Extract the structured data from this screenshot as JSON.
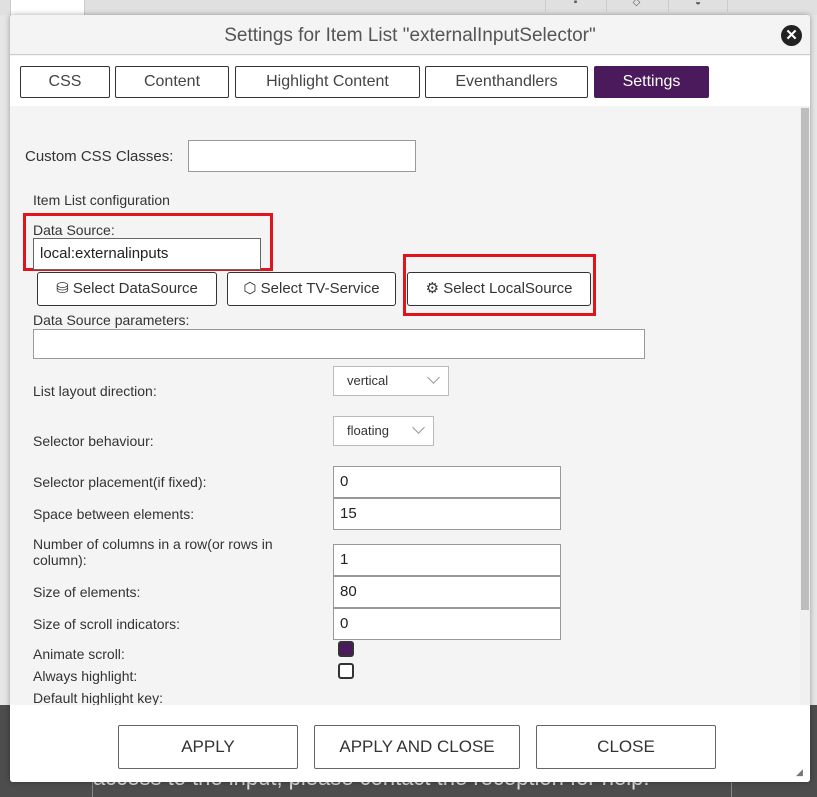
{
  "background": {
    "message": "access to the input, please contact the reception for help."
  },
  "dialog": {
    "title": "Settings for Item List \"externalInputSelector\"",
    "close_icon": "close-circle-icon",
    "tabs": [
      {
        "label": "CSS",
        "active": false
      },
      {
        "label": "Content",
        "active": false
      },
      {
        "label": "Highlight Content",
        "active": false
      },
      {
        "label": "Eventhandlers",
        "active": false
      },
      {
        "label": "Settings",
        "active": true
      }
    ],
    "accent_color": "#4a1a5c",
    "highlight_color": "#e0141b"
  },
  "settings": {
    "custom_css_label": "Custom CSS Classes:",
    "custom_css_value": "",
    "section_title": "Item List configuration",
    "data_source_label": "Data Source:",
    "data_source_value": "local:externalinputs",
    "select_datasource": "Select DataSource",
    "select_tv_service": "Select TV-Service",
    "select_local_source": "Select LocalSource",
    "ds_params_label": "Data Source parameters:",
    "ds_params_value": "",
    "layout_direction_label": "List layout direction:",
    "layout_direction_value": "vertical",
    "selector_behaviour_label": "Selector behaviour:",
    "selector_behaviour_value": "floating",
    "selector_placement_label": "Selector placement(if fixed):",
    "selector_placement_value": "0",
    "space_label": "Space between elements:",
    "space_value": "15",
    "columns_label": "Number of columns in a row(or rows in column):",
    "columns_value": "1",
    "size_label": "Size of elements:",
    "size_value": "80",
    "scroll_ind_label": "Size of scroll indicators:",
    "scroll_ind_value": "0",
    "animate_scroll_label": "Animate scroll:",
    "animate_scroll_checked": true,
    "always_highlight_label": "Always highlight:",
    "always_highlight_checked": false,
    "default_key_label": "Default highlight key:"
  },
  "footer": {
    "apply": "APPLY",
    "apply_close": "APPLY AND CLOSE",
    "close": "CLOSE"
  }
}
